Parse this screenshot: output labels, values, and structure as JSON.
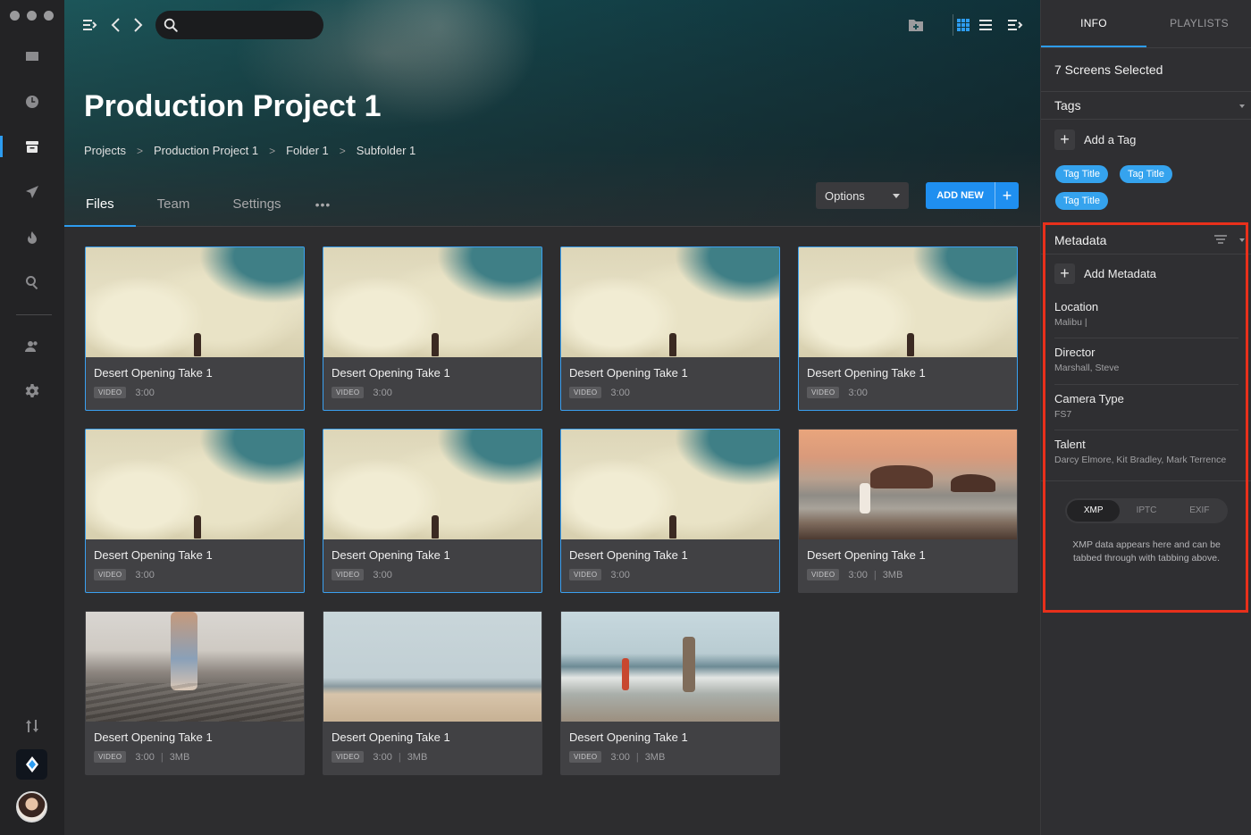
{
  "rail": {
    "items": [
      {
        "icon": "inbox-icon"
      },
      {
        "icon": "clock-icon"
      },
      {
        "icon": "archive-icon",
        "active": true
      },
      {
        "icon": "send-icon"
      },
      {
        "icon": "fire-icon"
      },
      {
        "icon": "search-icon"
      },
      {
        "icon": "users-icon"
      },
      {
        "icon": "gear-icon"
      }
    ],
    "bottom": [
      "sort-arrows-icon",
      "app-logo-icon",
      "user-avatar"
    ]
  },
  "toolbar": {
    "search_placeholder": "",
    "icons": [
      "sidebar-toggle-icon",
      "back-icon",
      "forward-icon",
      "search-icon",
      "new-folder-icon",
      "grid-view-icon",
      "list-view-icon",
      "panel-toggle-icon"
    ]
  },
  "header": {
    "title": "Production Project 1",
    "breadcrumb": [
      "Projects",
      "Production Project 1",
      "Folder 1",
      "Subfolder 1"
    ],
    "tabs": [
      "Files",
      "Team",
      "Settings"
    ],
    "active_tab": "Files",
    "more": "•••",
    "options_label": "Options",
    "add_new_label": "ADD NEW",
    "add_new_plus": "+"
  },
  "files": [
    {
      "title": "Desert Opening Take 1",
      "badge": "VIDEO",
      "duration": "3:00",
      "size": "",
      "thumb": "sky",
      "selected": true
    },
    {
      "title": "Desert Opening Take 1",
      "badge": "VIDEO",
      "duration": "3:00",
      "size": "",
      "thumb": "sky",
      "selected": true
    },
    {
      "title": "Desert Opening Take 1",
      "badge": "VIDEO",
      "duration": "3:00",
      "size": "",
      "thumb": "sky",
      "selected": true
    },
    {
      "title": "Desert Opening Take 1",
      "badge": "VIDEO",
      "duration": "3:00",
      "size": "",
      "thumb": "sky",
      "selected": true
    },
    {
      "title": "Desert Opening Take 1",
      "badge": "VIDEO",
      "duration": "3:00",
      "size": "",
      "thumb": "sky",
      "selected": true
    },
    {
      "title": "Desert Opening Take 1",
      "badge": "VIDEO",
      "duration": "3:00",
      "size": "",
      "thumb": "sky",
      "selected": true
    },
    {
      "title": "Desert Opening Take 1",
      "badge": "VIDEO",
      "duration": "3:00",
      "size": "",
      "thumb": "sky",
      "selected": true
    },
    {
      "title": "Desert Opening Take 1",
      "badge": "VIDEO",
      "duration": "3:00",
      "size": "3MB",
      "thumb": "sunset",
      "selected": false
    },
    {
      "title": "Desert Opening Take 1",
      "badge": "VIDEO",
      "duration": "3:00",
      "size": "3MB",
      "thumb": "beach",
      "selected": false
    },
    {
      "title": "Desert Opening Take 1",
      "badge": "VIDEO",
      "duration": "3:00",
      "size": "3MB",
      "thumb": "coast",
      "selected": false
    },
    {
      "title": "Desert Opening Take 1",
      "badge": "VIDEO",
      "duration": "3:00",
      "size": "3MB",
      "thumb": "kids",
      "selected": false
    }
  ],
  "panel": {
    "tabs": [
      "INFO",
      "PLAYLISTS"
    ],
    "active_tab": "INFO",
    "selection": "7 Screens Selected",
    "tags_heading": "Tags",
    "add_tag": "Add a Tag",
    "tags": [
      "Tag Title",
      "Tag Title",
      "Tag Title"
    ],
    "metadata_heading": "Metadata",
    "add_metadata": "Add Metadata",
    "metadata": [
      {
        "key": "Location",
        "value": "Malibu |"
      },
      {
        "key": "Director",
        "value": "Marshall, Steve"
      },
      {
        "key": "Camera Type",
        "value": "FS7"
      },
      {
        "key": "Talent",
        "value": "Darcy Elmore, Kit Bradley, Mark Terrence"
      }
    ],
    "format_tabs": [
      "XMP",
      "IPTC",
      "EXIF"
    ],
    "active_format": "XMP",
    "format_note": "XMP data appears here and can be tabbed through with tabbing above."
  },
  "colors": {
    "accent": "#2d9cf0",
    "tag": "#35a3ee",
    "highlight_box": "#e8301b",
    "panel_bg": "#2f2f32",
    "main_bg": "#2d2d2f"
  }
}
